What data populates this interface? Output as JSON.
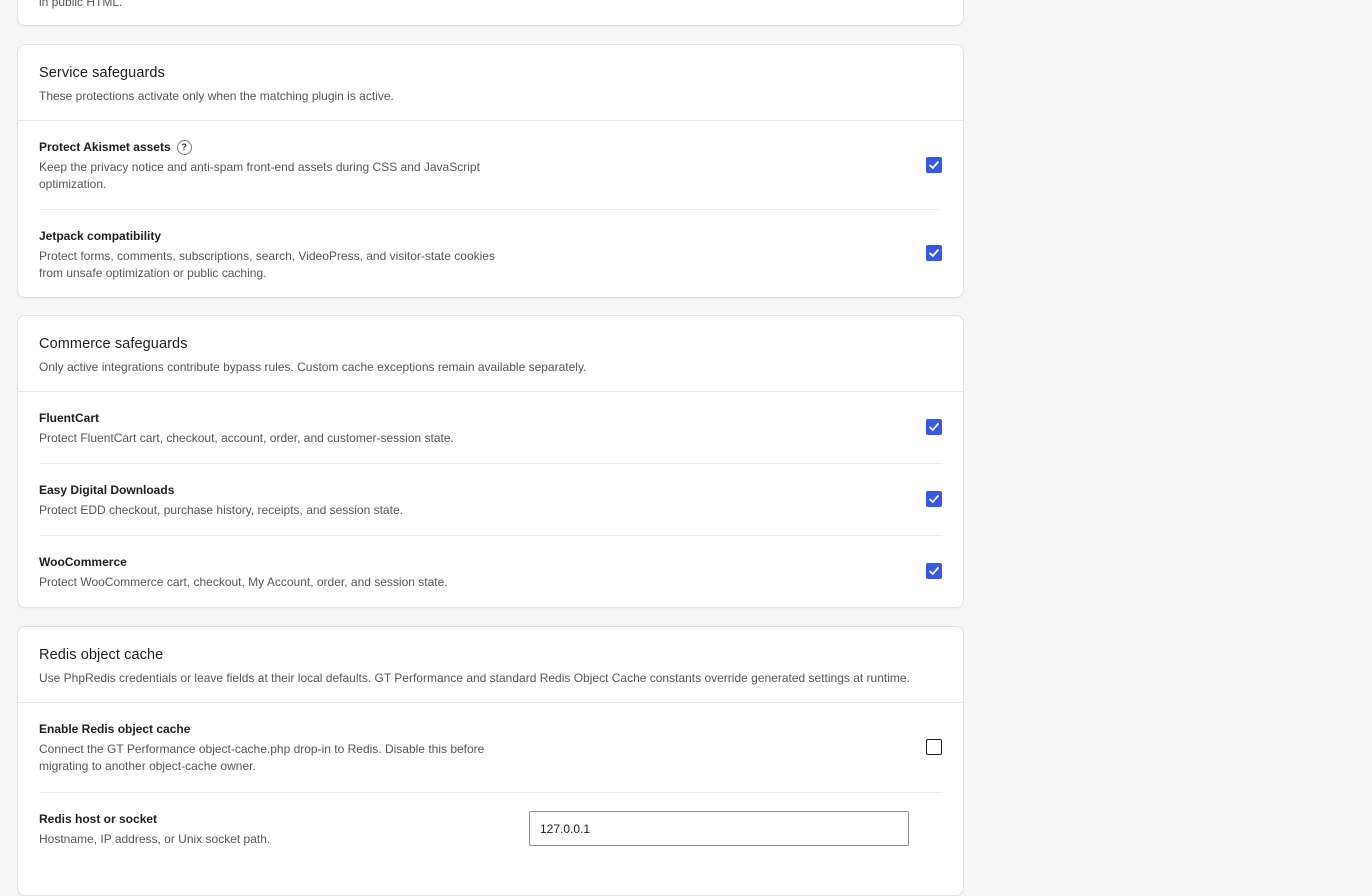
{
  "top_card": {
    "truncated_text": "in public HTML."
  },
  "service": {
    "title": "Service safeguards",
    "description": "These protections activate only when the matching plugin is active.",
    "rows": [
      {
        "label": "Protect Akismet assets",
        "help_icon": "question-circle-icon",
        "help_glyph": "?",
        "description": "Keep the privacy notice and anti-spam front-end assets during CSS and JavaScript optimization.",
        "checked": true
      },
      {
        "label": "Jetpack compatibility",
        "description": "Protect forms, comments, subscriptions, search, VideoPress, and visitor-state cookies from unsafe optimization or public caching.",
        "checked": true
      }
    ]
  },
  "commerce": {
    "title": "Commerce safeguards",
    "description": "Only active integrations contribute bypass rules. Custom cache exceptions remain available separately.",
    "rows": [
      {
        "label": "FluentCart",
        "description": "Protect FluentCart cart, checkout, account, order, and customer-session state.",
        "checked": true
      },
      {
        "label": "Easy Digital Downloads",
        "description": "Protect EDD checkout, purchase history, receipts, and session state.",
        "checked": true
      },
      {
        "label": "WooCommerce",
        "description": "Protect WooCommerce cart, checkout, My Account, order, and session state.",
        "checked": true
      }
    ]
  },
  "redis": {
    "title": "Redis object cache",
    "description": "Use PhpRedis credentials or leave fields at their local defaults. GT Performance and standard Redis Object Cache constants override generated settings at runtime.",
    "enable": {
      "label": "Enable Redis object cache",
      "description": "Connect the GT Performance object-cache.php drop-in to Redis. Disable this before migrating to another object-cache owner.",
      "checked": false
    },
    "host": {
      "label": "Redis host or socket",
      "description": "Hostname, IP address, or Unix socket path.",
      "value": "127.0.0.1"
    }
  },
  "colors": {
    "accent": "#3858e9",
    "page_bg": "#f6f6f7",
    "card_border": "#e0e0e0",
    "muted_text": "#50575e"
  }
}
